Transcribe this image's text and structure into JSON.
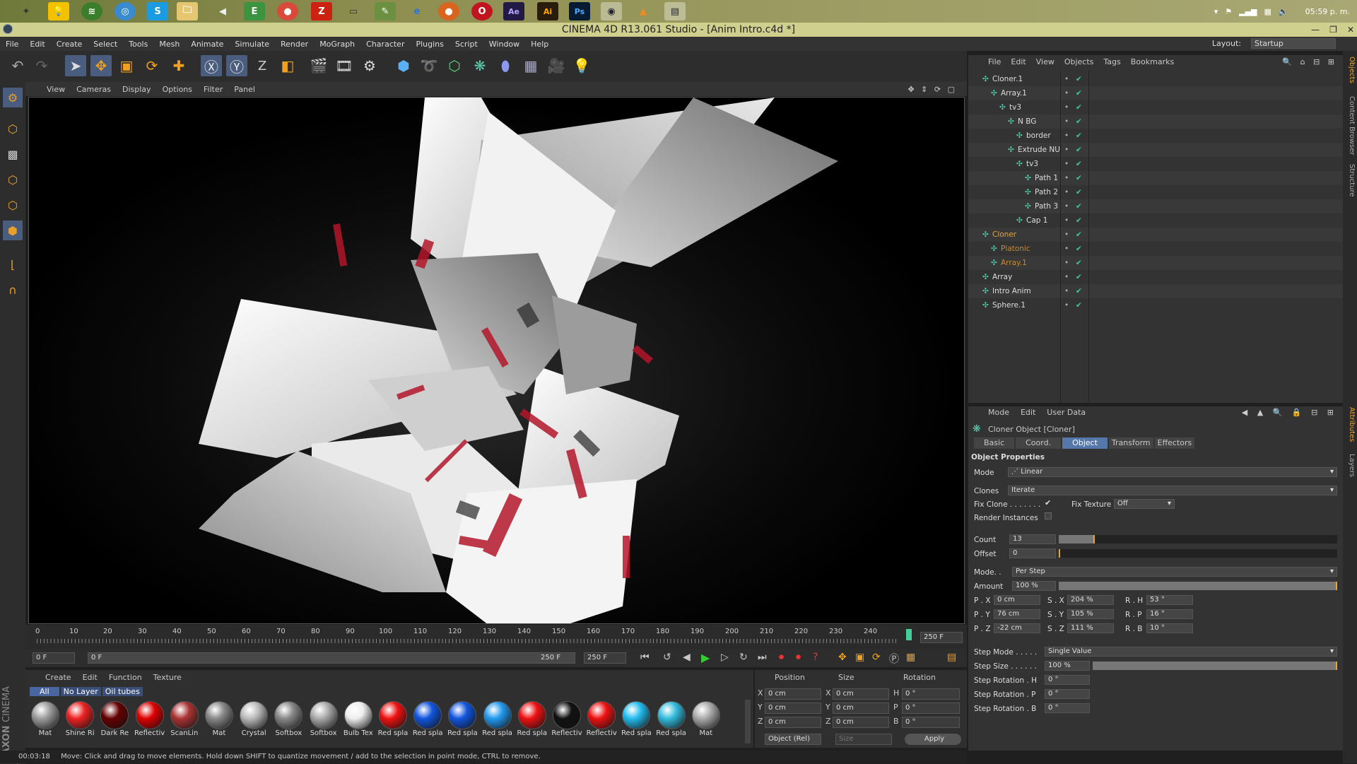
{
  "taskbar": {
    "clock": "05:59 p. m.",
    "icons": [
      "C4D",
      "bulb",
      "spotify",
      "safari",
      "skype",
      "folder",
      "vlc",
      "evernote",
      "chrome",
      "filezilla",
      "minimize",
      "notepad",
      "ie",
      "firefox",
      "opera",
      "ae",
      "ai",
      "ps",
      "cinema4d",
      "vlc-cone",
      "files"
    ]
  },
  "window": {
    "title": "CINEMA 4D R13.061 Studio - [Anim Intro.c4d *]"
  },
  "menubar": {
    "items": [
      "File",
      "Edit",
      "Create",
      "Select",
      "Tools",
      "Mesh",
      "Animate",
      "Simulate",
      "Render",
      "MoGraph",
      "Character",
      "Plugins",
      "Script",
      "Window",
      "Help"
    ],
    "layout_label": "Layout:",
    "layout_value": "Startup"
  },
  "viewport": {
    "menu": [
      "View",
      "Cameras",
      "Display",
      "Options",
      "Filter",
      "Panel"
    ]
  },
  "timeline": {
    "ticks": [
      "0",
      "10",
      "20",
      "30",
      "40",
      "50",
      "60",
      "70",
      "80",
      "90",
      "100",
      "110",
      "120",
      "130",
      "140",
      "150",
      "160",
      "170",
      "180",
      "190",
      "200",
      "210",
      "220",
      "230",
      "240"
    ],
    "end_frame": "250 F",
    "current_start": "0 F",
    "range_start": "0 F",
    "range_end": "250 F",
    "max_frame": "250 F"
  },
  "material_manager": {
    "menu": [
      "Create",
      "Edit",
      "Function",
      "Texture"
    ],
    "filters": [
      "All",
      "No Layer",
      "Oil tubes"
    ],
    "materials": [
      {
        "name": "Mat",
        "color": "#9c9c9c"
      },
      {
        "name": "Shine Ri",
        "color": "#e22"
      },
      {
        "name": "Dark Re",
        "color": "#600"
      },
      {
        "name": "Reflectiv",
        "color": "#d00"
      },
      {
        "name": "ScanLin",
        "color": "#a33"
      },
      {
        "name": "Mat",
        "color": "#888"
      },
      {
        "name": "Crystal",
        "color": "#bbb"
      },
      {
        "name": "Softbox",
        "color": "#888"
      },
      {
        "name": "Softbox",
        "color": "#aaa"
      },
      {
        "name": "Bulb Tex",
        "color": "#eee"
      },
      {
        "name": "Red spla",
        "color": "#e11"
      },
      {
        "name": "Red spla",
        "color": "#15d"
      },
      {
        "name": "Red spla",
        "color": "#15d"
      },
      {
        "name": "Red spla",
        "color": "#29e"
      },
      {
        "name": "Red spla",
        "color": "#e11"
      },
      {
        "name": "Reflectiv",
        "color": "#111"
      },
      {
        "name": "Reflectiv",
        "color": "#e11"
      },
      {
        "name": "Red spla",
        "color": "#2be"
      },
      {
        "name": "Red spla",
        "color": "#3bd"
      },
      {
        "name": "Mat",
        "color": "#aaa"
      }
    ]
  },
  "coord_manager": {
    "headers": [
      "Position",
      "Size",
      "Rotation"
    ],
    "rows": [
      [
        "X",
        "0 cm",
        "X",
        "0 cm",
        "H",
        "0 °"
      ],
      [
        "Y",
        "0 cm",
        "Y",
        "0 cm",
        "P",
        "0 °"
      ],
      [
        "Z",
        "0 cm",
        "Z",
        "0 cm",
        "B",
        "0 °"
      ]
    ],
    "mode": "Object (Rel)",
    "size_mode": "Size",
    "apply": "Apply"
  },
  "status": {
    "time": "00:03:18",
    "message": "Move: Click and drag to move elements. Hold down SHIFT to quantize movement / add to the selection in point mode, CTRL to remove."
  },
  "object_manager": {
    "menu": [
      "File",
      "Edit",
      "View",
      "Objects",
      "Tags",
      "Bookmarks"
    ],
    "objects": [
      {
        "name": "Cloner.1",
        "indent": 0,
        "color": "#ddd"
      },
      {
        "name": "Array.1",
        "indent": 1,
        "color": "#ddd"
      },
      {
        "name": "tv3",
        "indent": 2,
        "color": "#ddd"
      },
      {
        "name": "N BG",
        "indent": 3,
        "color": "#ddd"
      },
      {
        "name": "border",
        "indent": 4,
        "color": "#ddd"
      },
      {
        "name": "Extrude NU",
        "indent": 3,
        "color": "#ddd"
      },
      {
        "name": "tv3",
        "indent": 4,
        "color": "#ddd"
      },
      {
        "name": "Path 1",
        "indent": 5,
        "color": "#ddd"
      },
      {
        "name": "Path 2",
        "indent": 5,
        "color": "#ddd"
      },
      {
        "name": "Path 3",
        "indent": 5,
        "color": "#ddd"
      },
      {
        "name": "Cap 1",
        "indent": 4,
        "color": "#ddd"
      },
      {
        "name": "Cloner",
        "indent": 0,
        "color": "#e8a33a"
      },
      {
        "name": "Platonic",
        "indent": 1,
        "color": "#c68a30"
      },
      {
        "name": "Array.1",
        "indent": 1,
        "color": "#c68a30"
      },
      {
        "name": "Array",
        "indent": 0,
        "color": "#ddd"
      },
      {
        "name": "Intro Anim",
        "indent": 0,
        "color": "#ddd"
      },
      {
        "name": "Sphere.1",
        "indent": 0,
        "color": "#ddd"
      }
    ]
  },
  "attr_manager": {
    "menu": [
      "Mode",
      "Edit",
      "User Data"
    ],
    "title": "Cloner Object [Cloner]",
    "tabs": [
      "Basic",
      "Coord.",
      "Object",
      "Transform",
      "Effectors"
    ],
    "section": "Object Properties",
    "mode_label": "Mode",
    "mode_value": "Linear",
    "clones_label": "Clones",
    "clones_value": "Iterate",
    "fix_clone": "Fix Clone . . . . . . .",
    "fix_texture": "Fix Texture",
    "fix_texture_value": "Off",
    "render_instances": "Render Instances",
    "count_label": "Count",
    "count_value": "13",
    "offset_label": "Offset",
    "offset_value": "0",
    "mode2_label": "Mode. .",
    "mode2_value": "Per Step",
    "amount_label": "Amount",
    "amount_value": "100 %",
    "px": "0 cm",
    "py": "76 cm",
    "pz": "-22 cm",
    "sx": "204 %",
    "sy": "105 %",
    "sz": "111 %",
    "rh": "53 °",
    "rp": "16 °",
    "rb": "10 °",
    "step_mode_label": "Step Mode . . . . .",
    "step_mode_value": "Single Value",
    "step_size_label": "Step Size . . . . . .",
    "step_size_value": "100 %",
    "step_rot_h_label": "Step Rotation . H",
    "step_rot_h": "0 °",
    "step_rot_p_label": "Step Rotation . P",
    "step_rot_p": "0 °",
    "step_rot_b_label": "Step Rotation . B",
    "step_rot_b": "0 °"
  },
  "right_tabs": [
    "Objects",
    "Content Browser",
    "Structure",
    "Attributes",
    "Layers"
  ]
}
